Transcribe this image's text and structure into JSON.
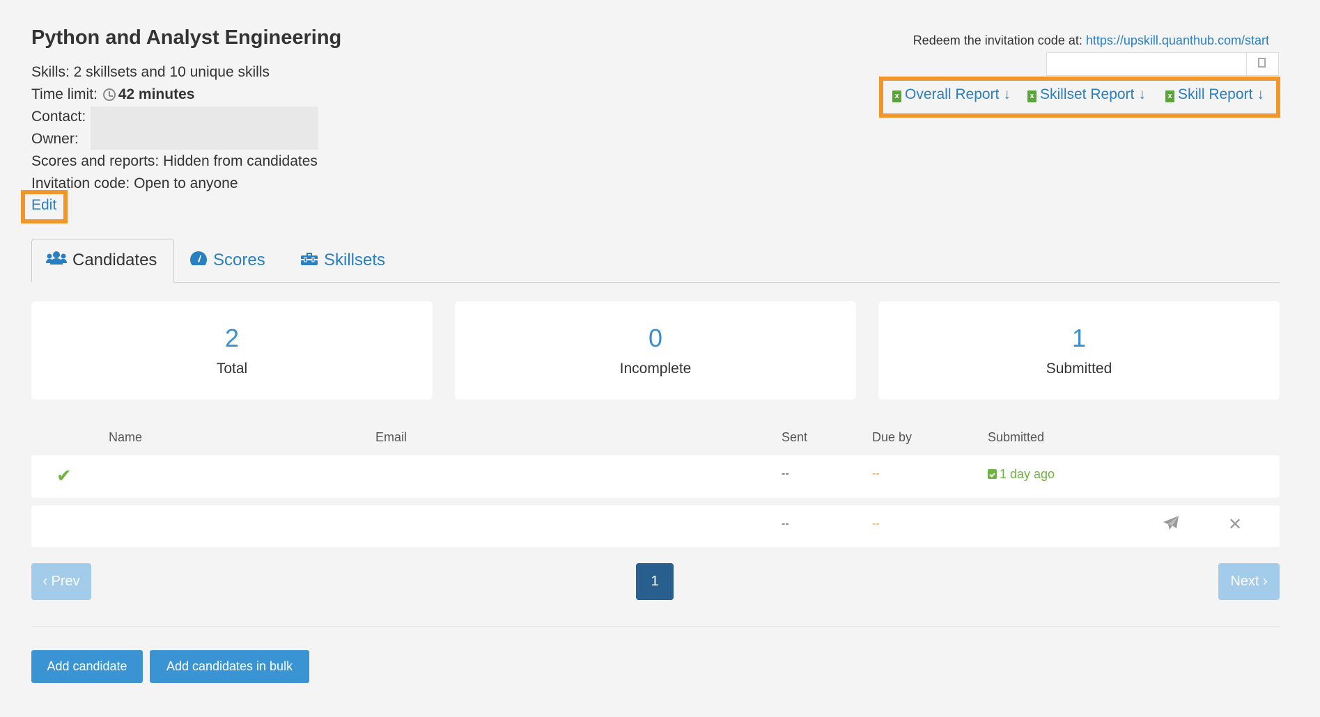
{
  "header": {
    "title": "Python and Analyst Engineering",
    "skills_text": "Skills: 2 skillsets and 10 unique skills",
    "time_limit_label": "Time limit:",
    "time_limit_value": "42 minutes",
    "contact_label": "Contact:",
    "owner_label": "Owner:",
    "scores_text": "Scores and reports: Hidden from candidates",
    "invitation_text": "Invitation code: Open to anyone",
    "edit_label": "Edit"
  },
  "redeem": {
    "label": "Redeem the invitation code at:",
    "url": "https://upskill.quanthub.com/start",
    "code_value": ""
  },
  "reports": {
    "overall": "Overall Report",
    "skillset": "Skillset Report",
    "skill": "Skill Report",
    "file_badge": "x"
  },
  "tabs": [
    {
      "label": "Candidates",
      "icon": "users-icon",
      "active": true
    },
    {
      "label": "Scores",
      "icon": "gauge-icon",
      "active": false
    },
    {
      "label": "Skillsets",
      "icon": "toolbox-icon",
      "active": false
    }
  ],
  "stats": [
    {
      "value": "2",
      "label": "Total"
    },
    {
      "value": "0",
      "label": "Incomplete"
    },
    {
      "value": "1",
      "label": "Submitted"
    }
  ],
  "table": {
    "columns": [
      "Name",
      "Email",
      "Sent",
      "Due by",
      "Submitted"
    ],
    "rows": [
      {
        "status_icon": "check-icon",
        "sent": "--",
        "due_by": "--",
        "submitted": "1 day ago"
      },
      {
        "status_icon": "",
        "sent": "--",
        "due_by": "--",
        "submitted": ""
      }
    ]
  },
  "pagination": {
    "prev": "‹ Prev",
    "current": "1",
    "next": "Next ›"
  },
  "actions": {
    "add_candidate": "Add candidate",
    "add_bulk": "Add candidates in bulk"
  },
  "colors": {
    "accent": "#2a7fc0",
    "highlight": "#f0962a",
    "success": "#6db33f",
    "page_active": "#285f8f"
  }
}
